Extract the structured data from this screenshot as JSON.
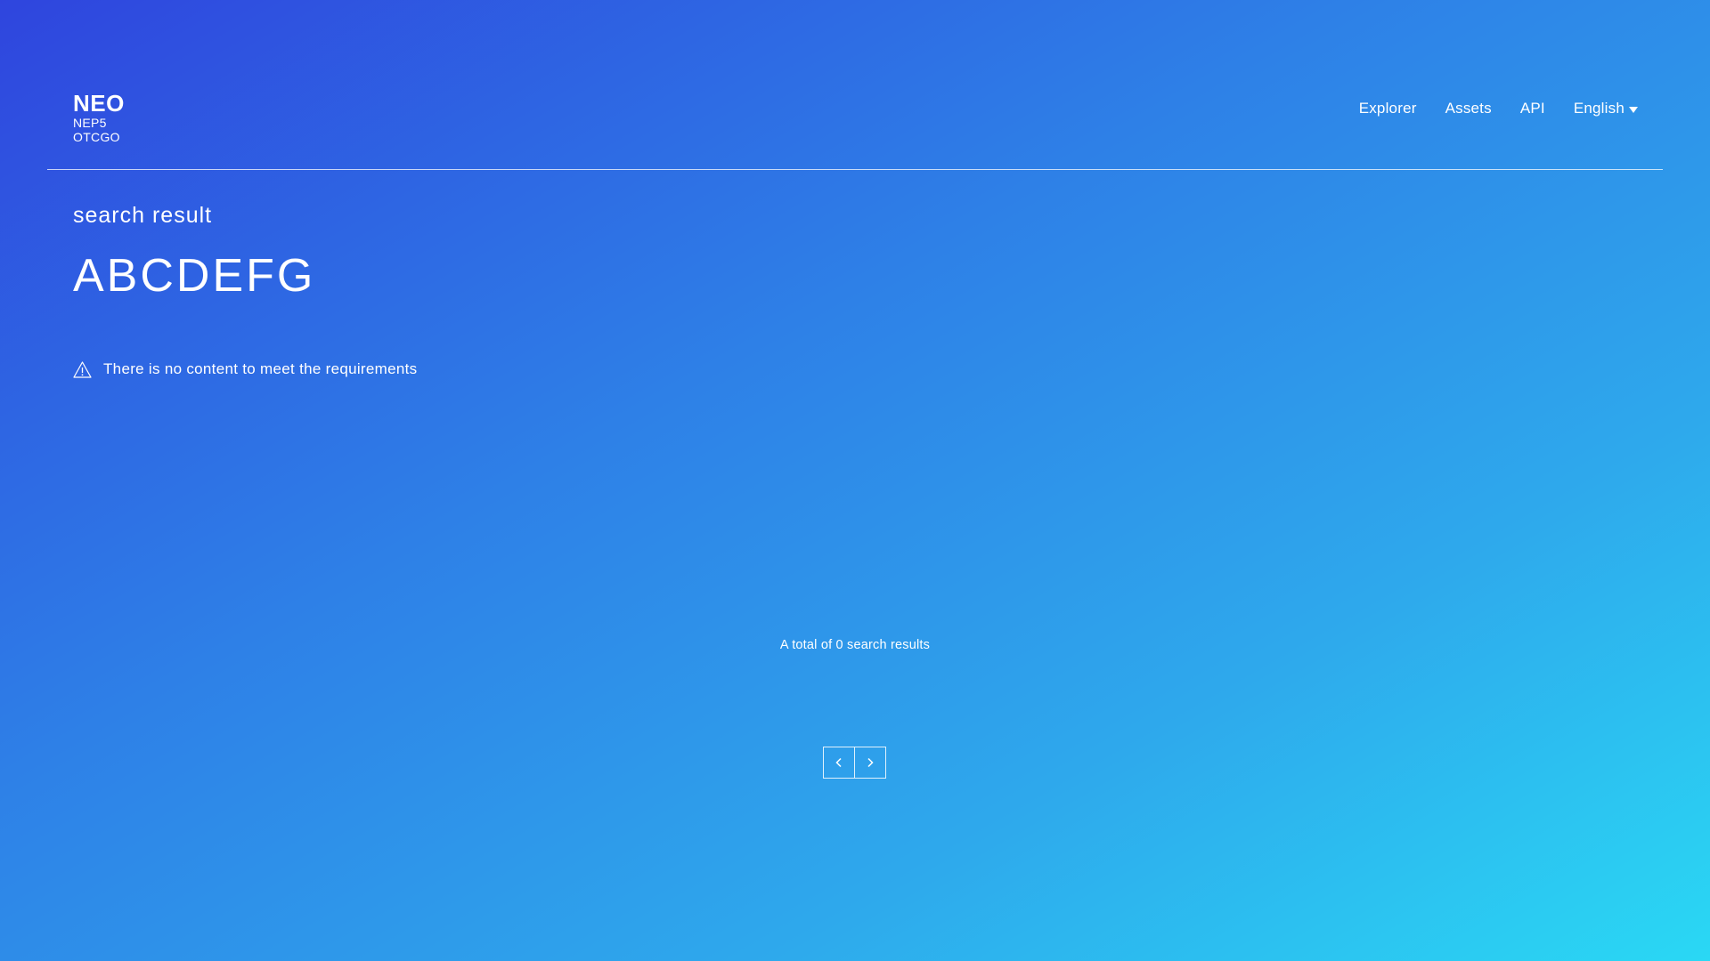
{
  "header": {
    "logo": {
      "title": "NEO",
      "lines": [
        "NEP5",
        "OTCGO"
      ]
    },
    "nav": {
      "explorer": "Explorer",
      "assets": "Assets",
      "api": "API",
      "language": "English"
    }
  },
  "main": {
    "section_label": "search result",
    "query": "ABCDEFG",
    "empty_message": "There is no content to meet the requirements",
    "total_text": "A total of 0 search results"
  },
  "pagination": {
    "prev_icon": "chevron-left-icon",
    "next_icon": "chevron-right-icon"
  },
  "colors": {
    "gradient_start": "#2f45de",
    "gradient_end": "#2ad8f4",
    "text": "#ffffff"
  }
}
